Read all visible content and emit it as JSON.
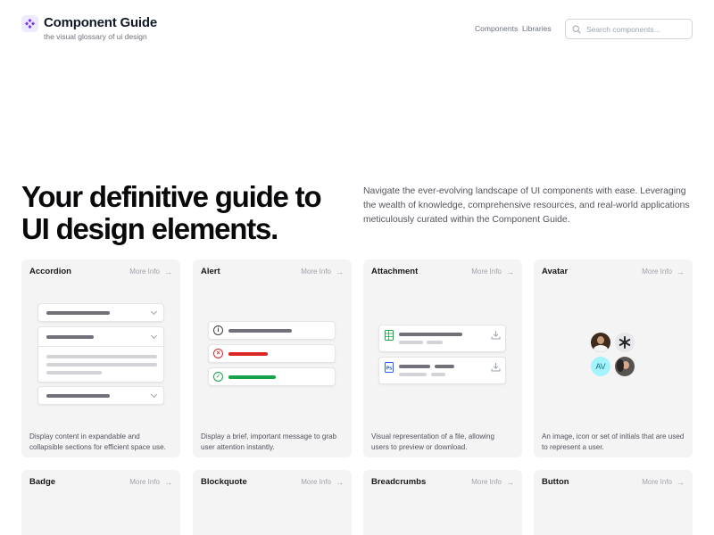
{
  "header": {
    "title": "Component Guide",
    "subtitle": "the visual glossary of ui design",
    "nav": {
      "components": "Components",
      "libraries": "Libraries"
    },
    "search_placeholder": "Search components..."
  },
  "hero": {
    "title": "Your definitive guide to UI design elements.",
    "description": "Navigate the ever-evolving landscape of UI components with ease. Leveraging the wealth of knowledge, comprehensive resources, and real-world applications meticulously curated within the Component Guide."
  },
  "more_info_label": "More Info",
  "cards": [
    {
      "title": "Accordion",
      "description": "Display content in expandable and collapsible sections for efficient space use."
    },
    {
      "title": "Alert",
      "description": "Display a brief, important message to grab user attention instantly."
    },
    {
      "title": "Attachment",
      "description": "Visual representation of a file, allowing users to preview or download."
    },
    {
      "title": "Avatar",
      "description": "An image, icon or set of initials that are used to represent a user.",
      "initials": "AV"
    },
    {
      "title": "Badge",
      "description": ""
    },
    {
      "title": "Blockquote",
      "description": ""
    },
    {
      "title": "Breadcrumbs",
      "description": ""
    },
    {
      "title": "Button",
      "description": ""
    }
  ],
  "colors": {
    "accent": "#7c3aed",
    "card_bg": "#f4f4f5",
    "error": "#dc2626",
    "success": "#16a34a",
    "excel": "#16a34a",
    "photoshop": "#2563eb"
  },
  "icons": [
    "logo-icon",
    "search-icon",
    "arrow-right-icon",
    "chevron-down-icon",
    "info-icon",
    "error-icon",
    "success-icon",
    "excel-file-icon",
    "photoshop-file-icon",
    "download-icon",
    "avatar-photo",
    "star-logo-icon"
  ]
}
